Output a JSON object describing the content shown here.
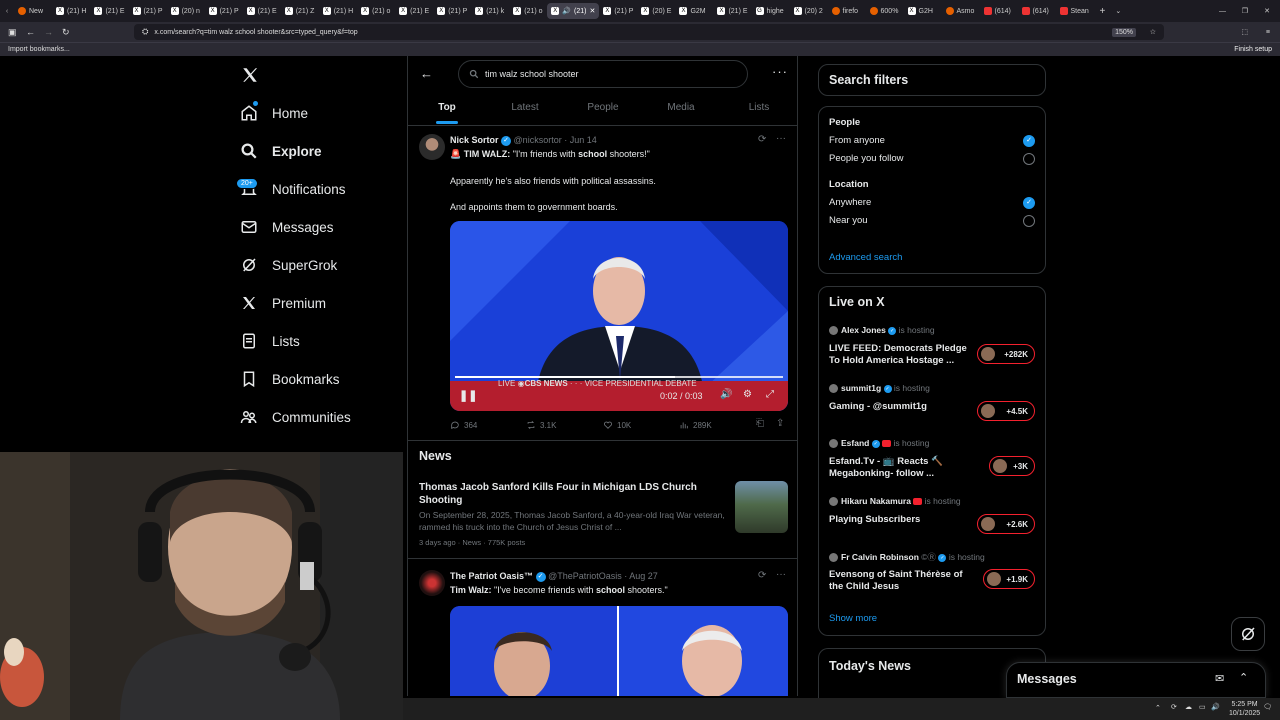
{
  "browser": {
    "tabs": [
      "New",
      "(21) H",
      "(21) E",
      "(21) P",
      "(20) n",
      "(21) P",
      "(21) E",
      "(21) Z",
      "(21) H",
      "(21) o",
      "(21) E",
      "(21) P",
      "(21) k",
      "(21) o",
      "(21)",
      "(21) P",
      "(20) E",
      "G2M",
      "(21) E",
      "highe",
      "(20) 2",
      "firefo",
      "600%",
      "G2H",
      "Asmo",
      "(614)",
      "(614)",
      "Stean"
    ],
    "url": "x.com/search?q=tim walz school shooter&src=typed_query&f=top",
    "zoom": "150%",
    "bookmark": "Import bookmarks...",
    "finish_setup": "Finish setup"
  },
  "nav": {
    "home": "Home",
    "explore": "Explore",
    "notifications": "Notifications",
    "notif_badge": "20+",
    "messages": "Messages",
    "supergrok": "SuperGrok",
    "premium": "Premium",
    "lists": "Lists",
    "bookmarks": "Bookmarks",
    "communities": "Communities"
  },
  "search": {
    "query": "tim walz school shooter",
    "tabs": [
      "Top",
      "Latest",
      "People",
      "Media",
      "Lists"
    ]
  },
  "post1": {
    "name": "Nick Sortor",
    "handle": "@nicksortor",
    "date": "· Jun 14",
    "line1_prefix": "🚨 TIM WALZ:",
    "line1_a": " \"I'm friends with ",
    "line1_b": "school",
    "line1_c": " shooters!\"",
    "line2": "Apparently he's also friends with political assassins.",
    "line3": "And appoints them to government boards.",
    "video_time": "0:02 / 0:03",
    "chyron_live": "LIVE",
    "chyron_network": "CBS NEWS",
    "chyron_text": "VICE PRESIDENTIAL DEBATE",
    "replies": "364",
    "reposts": "3.1K",
    "likes": "10K",
    "views": "289K"
  },
  "news": {
    "header": "News",
    "title": "Thomas Jacob Sanford Kills Four in Michigan LDS Church Shooting",
    "summary": "On September 28, 2025, Thomas Jacob Sanford, a 40-year-old Iraq War veteran, rammed his truck into the Church of Jesus Christ of ...",
    "meta": "3 days ago · News · 775K posts"
  },
  "post2": {
    "name": "The Patriot Oasis™",
    "handle": "@ThePatriotOasis",
    "date": "· Aug 27",
    "text_a": "Tim Walz:",
    "text_b": " \"I've become friends with ",
    "text_c": "school",
    "text_d": " shooters.\""
  },
  "filters": {
    "title": "Search filters",
    "people_label": "People",
    "from_anyone": "From anyone",
    "people_you_follow": "People you follow",
    "location_label": "Location",
    "anywhere": "Anywhere",
    "near_you": "Near you",
    "advanced": "Advanced search"
  },
  "live": {
    "title": "Live on X",
    "hosting": "is hosting",
    "items": [
      {
        "host": "Alex Jones",
        "title": "LIVE FEED: Democrats Pledge To Hold America Hostage ...",
        "count": "+282K"
      },
      {
        "host": "summit1g",
        "title": "Gaming - @summit1g",
        "count": "+4.5K"
      },
      {
        "host": "Esfand",
        "title": "Esfand.Tv - 📺 Reacts 🔨 Megabonking- follow ...",
        "count": "+3K"
      },
      {
        "host": "Hikaru Nakamura",
        "title": "Playing Subscribers",
        "count": "+2.6K"
      },
      {
        "host": "Fr Calvin Robinson",
        "title": "Evensong of Saint Thérèse of the Child Jesus",
        "count": "+1.9K"
      }
    ],
    "show_more": "Show more"
  },
  "todays_news": "Today's News",
  "messages_drawer": "Messages",
  "taskbar": {
    "time": "5:25 PM",
    "date": "10/1/2025"
  },
  "colors": {
    "accent": "#1d9bf0",
    "live_ring": "#f4212e",
    "background": "#000000",
    "border": "#2f3336"
  }
}
